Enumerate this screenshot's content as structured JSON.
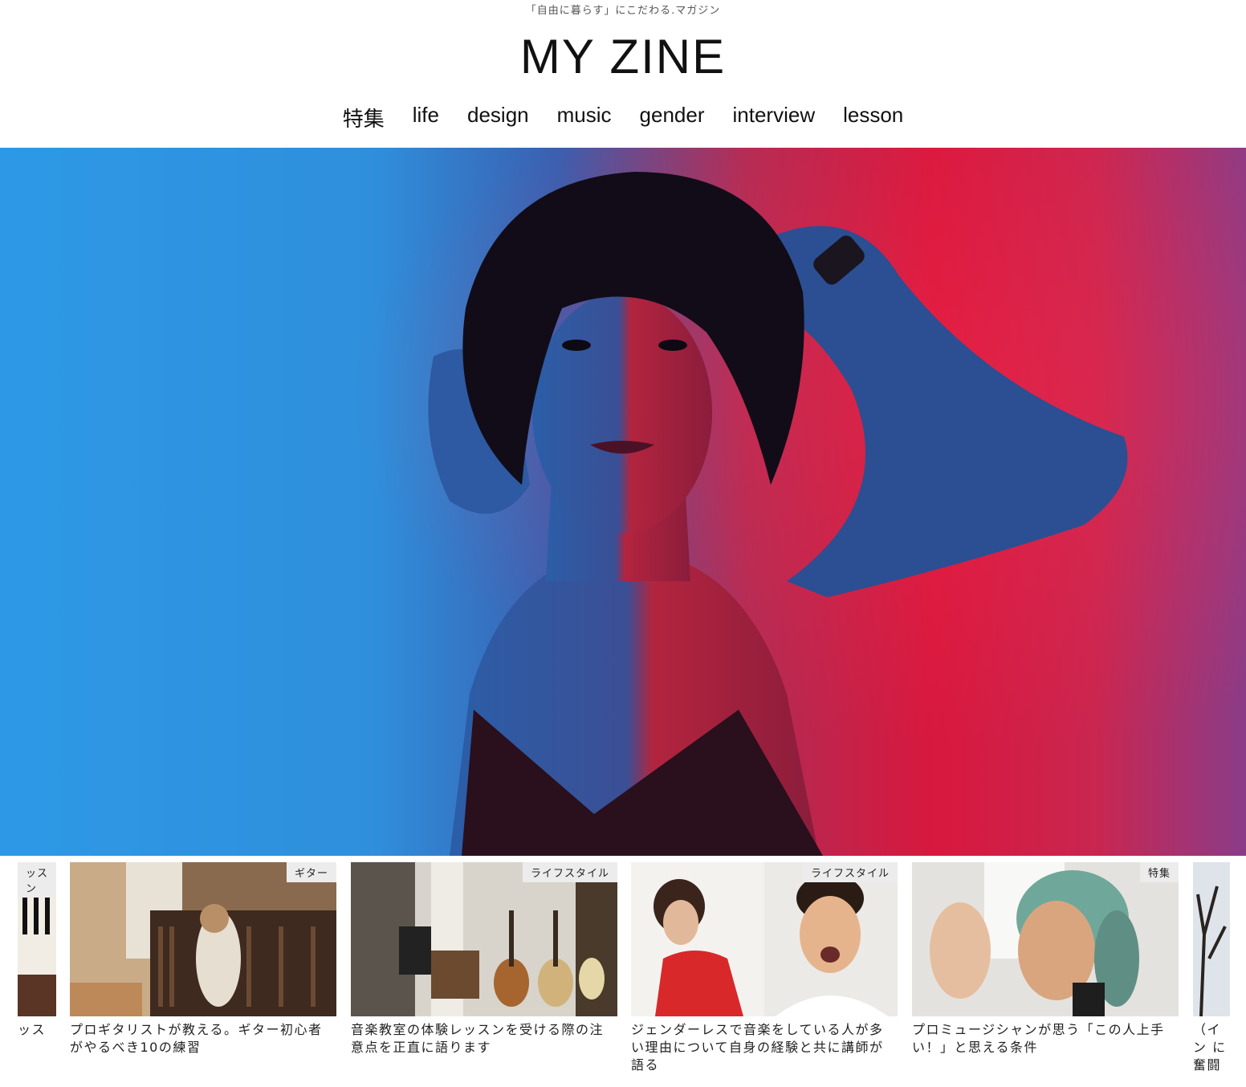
{
  "header": {
    "tagline": "「自由に暮らす」にこだわる.マガジン",
    "logo": "MY ZINE"
  },
  "nav": {
    "items": [
      "特集",
      "life",
      "design",
      "music",
      "gender",
      "interview",
      "lesson"
    ]
  },
  "hero": {
    "alt": "woman-portrait-blue-red-light"
  },
  "articles": [
    {
      "badge": "ッスン",
      "title": "ッス"
    },
    {
      "badge": "ギター",
      "title": "プロギタリストが教える。ギター初心者がやるべき10の練習"
    },
    {
      "badge": "ライフスタイル",
      "title": "音楽教室の体験レッスンを受ける際の注意点を正直に語ります"
    },
    {
      "badge": "ライフスタイル",
      "title": "ジェンダーレスで音楽をしている人が多い理由について自身の経験と共に講師が語る"
    },
    {
      "badge": "特集",
      "title": "プロミュージシャンが思う「この人上手い！」と思える条件"
    },
    {
      "badge": "",
      "title": "（イン に奮闘"
    }
  ]
}
